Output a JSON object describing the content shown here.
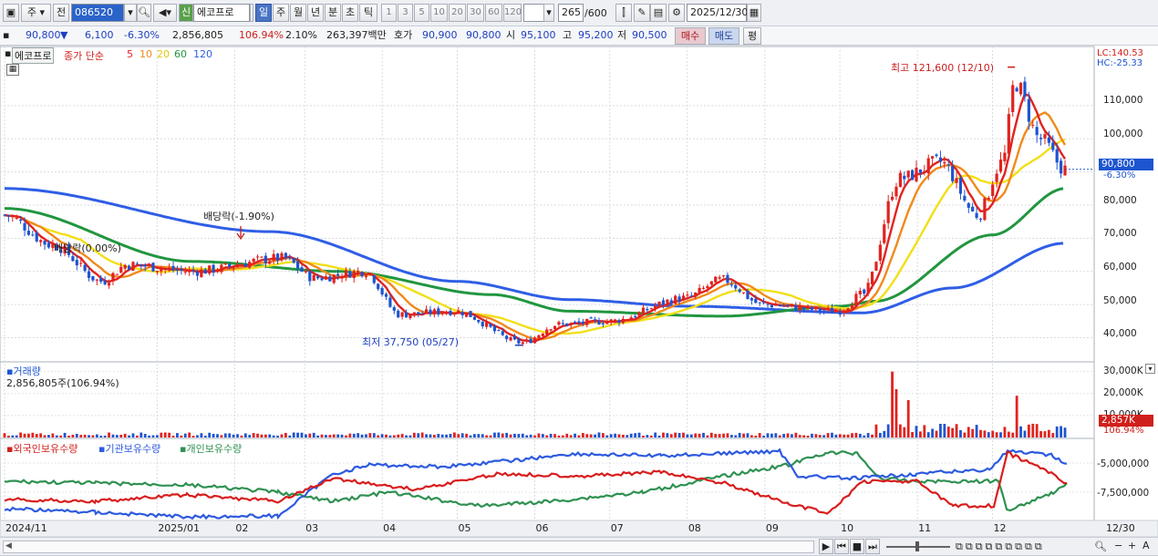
{
  "toolbar": {
    "period_select": "주",
    "prev_label": "전",
    "code": "086520",
    "stock_badge": "신",
    "stock_name": "에코프로",
    "periods": [
      "일",
      "주",
      "월",
      "년",
      "분",
      "초",
      "틱"
    ],
    "active_period": "일",
    "intervals": [
      "1",
      "3",
      "5",
      "10",
      "20",
      "30",
      "60",
      "120"
    ],
    "count": "265",
    "count_total": "/600",
    "date": "2025/12/30"
  },
  "quote": {
    "price": "90,800",
    "change_arrow": "▼",
    "change": "6,100",
    "change_pct": "-6.30%",
    "volume": "2,856,805",
    "volume_ratio": "106.94%",
    "turnover": "2.10%",
    "amount": "263,397백만",
    "bid_label": "호가",
    "bid1": "90,900",
    "bid2": "90,800",
    "open_label": "시",
    "open": "95,100",
    "high_label": "고",
    "high": "95,200",
    "low_label": "저",
    "low": "90,500",
    "buy_label": "매수",
    "sell_label": "매도",
    "avg_label": "평"
  },
  "price_panel": {
    "stock_tag": "에코프로",
    "legend_prefix": "종가 단순",
    "ma_labels": [
      "5",
      "10",
      "20",
      "60",
      "120"
    ],
    "lc": "LC:140.53",
    "hc": "HC:-25.33",
    "y_ticks": [
      "110,000",
      "100,000",
      "90,000",
      "80,000",
      "70,000",
      "60,000",
      "50,000",
      "40,000"
    ],
    "current_badge": "90,800",
    "current_pct": "-6.30%",
    "high_note": "최고 121,600 (12/10)",
    "low_note": "최저 37,750 (05/27)",
    "div_note1": "배당락(-1.90%)",
    "div_note2": "배당락(0.00%)"
  },
  "volume_panel": {
    "title": "거래량",
    "value": "2,856,805주(106.94%)",
    "y_ticks": [
      "30,000K",
      "20,000K",
      "10,000K"
    ],
    "badge": "2,857K",
    "badge_pct": "106.94%"
  },
  "holding_panel": {
    "legend": [
      "외국인보유수량",
      "기관보유수량",
      "개인보유수량"
    ],
    "y_ticks": [
      "-5,000,000",
      "-7,500,000"
    ]
  },
  "x_axis": [
    "2024/11",
    "2025/01",
    "02",
    "03",
    "04",
    "05",
    "06",
    "07",
    "08",
    "09",
    "10",
    "11",
    "12",
    "12/30"
  ],
  "colors": {
    "up": "#e0231f",
    "down": "#1d55d0",
    "ma5": "#e0231f",
    "ma10": "#f08a1c",
    "ma20": "#f2df17",
    "ma60": "#21963f",
    "ma120": "#2f5ee6",
    "foreign": "#d91d1d",
    "institution": "#2d5ae0",
    "individual": "#2f9152"
  },
  "chart_data": {
    "type": "candlestick",
    "price_series_anchors": [
      [
        "2024-11-01",
        77000
      ],
      [
        "2024-11-20",
        68000
      ],
      [
        "2024-12-10",
        57000
      ],
      [
        "2024-12-20",
        62000
      ],
      [
        "2025-01-15",
        60000
      ],
      [
        "2025-02-20",
        64000
      ],
      [
        "2025-03-05",
        58000
      ],
      [
        "2025-03-25",
        60000
      ],
      [
        "2025-04-08",
        47000
      ],
      [
        "2025-04-30",
        48000
      ],
      [
        "2025-05-27",
        38500
      ],
      [
        "2025-06-10",
        44000
      ],
      [
        "2025-07-01",
        45000
      ],
      [
        "2025-07-31",
        52000
      ],
      [
        "2025-08-15",
        57500
      ],
      [
        "2025-08-31",
        50000
      ],
      [
        "2025-09-30",
        48000
      ],
      [
        "2025-10-10",
        53000
      ],
      [
        "2025-10-25",
        88000
      ],
      [
        "2025-11-10",
        93000
      ],
      [
        "2025-11-25",
        77000
      ],
      [
        "2025-12-05",
        93000
      ],
      [
        "2025-12-10",
        117000
      ],
      [
        "2025-12-20",
        100000
      ],
      [
        "2025-12-30",
        90800
      ]
    ],
    "ma60_anchors": [
      [
        "2024-11-01",
        79000
      ],
      [
        "2025-01-15",
        63000
      ],
      [
        "2025-03-15",
        60000
      ],
      [
        "2025-05-15",
        53000
      ],
      [
        "2025-06-15",
        48000
      ],
      [
        "2025-08-15",
        46500
      ],
      [
        "2025-10-01",
        49500
      ],
      [
        "2025-10-15",
        51000
      ],
      [
        "2025-12-01",
        71000
      ],
      [
        "2025-12-30",
        85000
      ]
    ],
    "ma120_anchors": [
      [
        "2024-11-01",
        85000
      ],
      [
        "2025-02-15",
        72000
      ],
      [
        "2025-05-01",
        57000
      ],
      [
        "2025-06-15",
        51500
      ],
      [
        "2025-08-01",
        49500
      ],
      [
        "2025-10-10",
        47500
      ],
      [
        "2025-11-15",
        55000
      ],
      [
        "2025-12-30",
        68500
      ]
    ],
    "y_axis_range": [
      33000,
      127000
    ],
    "high": {
      "date": "2025-12-10",
      "value": 121600
    },
    "low": {
      "date": "2025-05-27",
      "value": 37750
    },
    "volume_range_k": [
      0,
      34000
    ],
    "volume_spikes_k": [
      [
        "2025-10-22",
        30000
      ],
      [
        "2025-10-24",
        22000
      ],
      [
        "2025-10-29",
        17000
      ],
      [
        "2025-12-10",
        19000
      ]
    ]
  }
}
